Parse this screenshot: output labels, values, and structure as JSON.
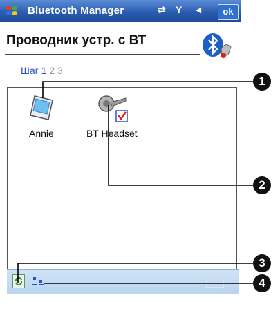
{
  "window": {
    "title": "Bluetooth Manager",
    "ok_label": "ok"
  },
  "header": {
    "heading": "Проводник устр. с ВТ"
  },
  "steps": {
    "label": "Шаг",
    "n1": "1",
    "n2": "2",
    "n3": "3"
  },
  "devices": [
    {
      "name": "Annie",
      "icon": "pda-icon"
    },
    {
      "name": "BT Headset",
      "icon": "headset-icon",
      "checked": true
    }
  ],
  "callouts": [
    "1",
    "2",
    "3",
    "4"
  ],
  "colors": {
    "titlebar": "#2a5db0",
    "accent_blue": "#2a4fd0",
    "bottombar": "#c4dbf1"
  }
}
